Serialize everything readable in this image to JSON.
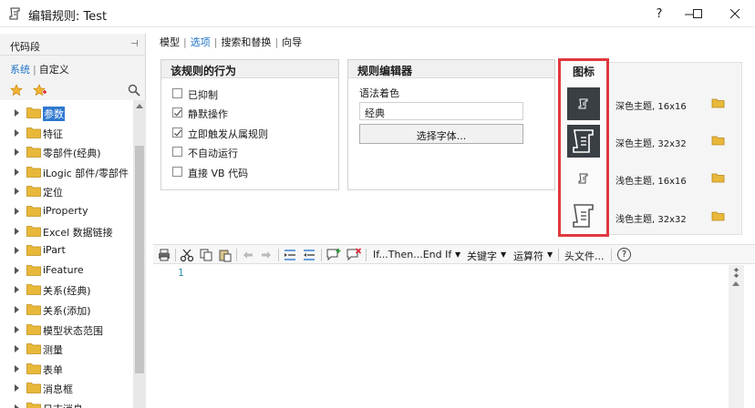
{
  "window": {
    "title": "编辑规则: Test",
    "controls": [
      "?",
      "minimize",
      "maximize",
      "close"
    ]
  },
  "sidebar": {
    "title": "代码段",
    "pin_glyph": "⊣",
    "tabs": [
      {
        "label": "系统",
        "active": true
      },
      {
        "label": "自定义",
        "active": false
      }
    ],
    "tree": [
      {
        "label": "参数",
        "selected": true
      },
      {
        "label": "特征"
      },
      {
        "label": "零部件(经典)"
      },
      {
        "label": "iLogic 部件/零部件"
      },
      {
        "label": "定位"
      },
      {
        "label": "iProperty"
      },
      {
        "label": "Excel 数据链接"
      },
      {
        "label": "iPart"
      },
      {
        "label": "iFeature"
      },
      {
        "label": "关系(经典)"
      },
      {
        "label": "关系(添加)"
      },
      {
        "label": "模型状态范围"
      },
      {
        "label": "测量"
      },
      {
        "label": "表单"
      },
      {
        "label": "消息框"
      },
      {
        "label": "日志消息"
      }
    ]
  },
  "topnav": {
    "items": [
      {
        "label": "模型",
        "active": false
      },
      {
        "label": "选项",
        "active": true
      },
      {
        "label": "搜索和替换",
        "active": false
      },
      {
        "label": "向导",
        "active": false
      }
    ]
  },
  "behavior": {
    "title": "该规则的行为",
    "options": [
      {
        "label": "已抑制",
        "checked": false
      },
      {
        "label": "静默操作",
        "checked": true
      },
      {
        "label": "立即触发从属规则",
        "checked": true
      },
      {
        "label": "不自动运行",
        "checked": false
      },
      {
        "label": "直接 VB 代码",
        "checked": false
      }
    ]
  },
  "editor_settings": {
    "title": "规则编辑器",
    "syntax_label": "语法着色",
    "syntax_value": "经典",
    "font_button": "选择字体..."
  },
  "icons": {
    "title": "图标",
    "items": [
      {
        "label": "深色主题, 16x16"
      },
      {
        "label": "深色主题, 32x32"
      },
      {
        "label": "浅色主题, 16x16"
      },
      {
        "label": "浅色主题, 32x32"
      }
    ]
  },
  "toolbar": {
    "if_then": "If...Then...End If",
    "keywords": "关键字",
    "operators": "运算符",
    "header": "头文件...",
    "help": "?"
  },
  "editor": {
    "line_number": "1"
  },
  "colors": {
    "accent": "#1e73c8",
    "highlight": "#e0383e",
    "folder": "#e8b83a",
    "dark_icon_bg": "#3a3f44"
  }
}
